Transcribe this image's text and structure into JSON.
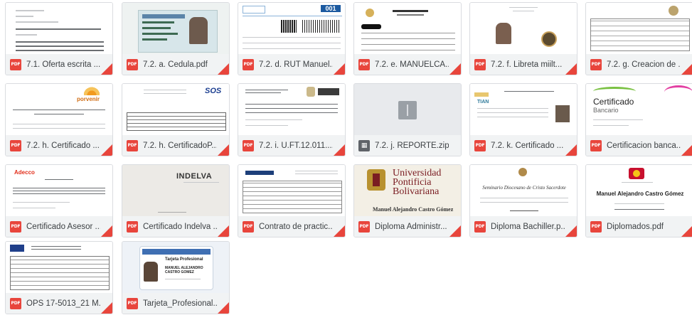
{
  "files": [
    {
      "name": "7.1. Oferta escrita ...",
      "type": "PDF"
    },
    {
      "name": "7.2. a. Cedula.pdf",
      "type": "PDF"
    },
    {
      "name": "7.2. d. RUT Manuel...",
      "type": "PDF"
    },
    {
      "name": "7.2. e. MANUELCA...",
      "type": "PDF"
    },
    {
      "name": "7.2. f. Libreta miilt...",
      "type": "PDF"
    },
    {
      "name": "7.2. g. Creacion de ...",
      "type": "PDF"
    },
    {
      "name": "7.2. h. Certificado ...",
      "type": "PDF"
    },
    {
      "name": "7.2. h. CertificadoP...",
      "type": "PDF"
    },
    {
      "name": "7.2. i. U.FT.12.011....",
      "type": "PDF"
    },
    {
      "name": "7.2. j. REPORTE.zip",
      "type": "ZIP"
    },
    {
      "name": "7.2. k. Certificado ...",
      "type": "PDF"
    },
    {
      "name": "Certificacion banca...",
      "type": "PDF"
    },
    {
      "name": "Certificado Asesor ...",
      "type": "PDF"
    },
    {
      "name": "Certificado Indelva ...",
      "type": "PDF"
    },
    {
      "name": "Contrato de practic...",
      "type": "PDF"
    },
    {
      "name": "Diploma Administr...",
      "type": "PDF"
    },
    {
      "name": "Diploma Bachiller.p...",
      "type": "PDF"
    },
    {
      "name": "Diplomados.pdf",
      "type": "PDF"
    },
    {
      "name": "OPS 17-5013_21 M...",
      "type": "PDF"
    },
    {
      "name": "Tarjeta_Profesional...",
      "type": "PDF"
    }
  ],
  "thumb_text": {
    "rut_number": "001",
    "porvenir": "porvenir",
    "sos": "SOS",
    "certificado": "Certificado",
    "bancario": "Bancario",
    "adecco": "Adecco",
    "indelva": "INDELVA",
    "universidad_1": "Universidad",
    "universidad_2": "Pontificia",
    "universidad_3": "Bolivariana",
    "diploma_name": "Manuel Alejandro Castro Gómez",
    "seminario": "Seminario Diocesano de Cristo Sacerdote",
    "diplomados_name": "Manuel Alejandro Castro Gómez",
    "tarjeta_title": "Tarjeta Profesional",
    "tarjeta_name": "MANUEL ALEJANDRO CASTRO GOMEZ"
  },
  "colors": {
    "pdf_red": "#e8453c",
    "tile_bg": "#f1f3f4",
    "text": "#3c4043"
  }
}
